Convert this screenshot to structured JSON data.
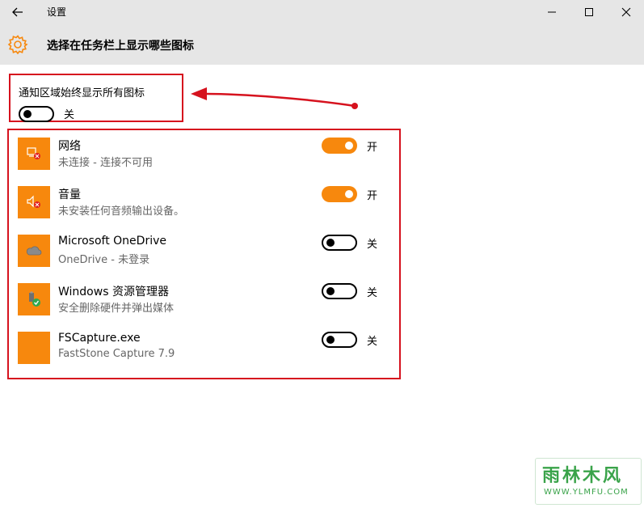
{
  "window": {
    "title": "设置",
    "controls": {
      "minimize": "minimize-icon",
      "maximize": "maximize-icon",
      "close": "close-icon"
    }
  },
  "header": {
    "icon": "gear-icon",
    "title": "选择在任务栏上显示哪些图标"
  },
  "master": {
    "label": "通知区域始终显示所有图标",
    "on": false,
    "state_label": "关"
  },
  "items": [
    {
      "name": "网络",
      "desc": "未连接 - 连接不可用",
      "on": true,
      "state_label": "开",
      "icon": "network-error-icon"
    },
    {
      "name": "音量",
      "desc": "未安装任何音频输出设备。",
      "on": true,
      "state_label": "开",
      "icon": "volume-error-icon"
    },
    {
      "name": "Microsoft OneDrive",
      "desc": "OneDrive - 未登录",
      "on": false,
      "state_label": "关",
      "icon": "cloud-icon"
    },
    {
      "name": "Windows 资源管理器",
      "desc": "安全删除硬件并弹出媒体",
      "on": false,
      "state_label": "关",
      "icon": "usb-eject-icon"
    },
    {
      "name": "FSCapture.exe",
      "desc": "FastStone Capture 7.9",
      "on": false,
      "state_label": "关",
      "icon": "app-icon"
    }
  ],
  "colors": {
    "accent": "#f7880d",
    "annotation": "#d6121e",
    "titlebar": "#e6e6e6"
  },
  "watermark": {
    "logo": "雨林木风",
    "url": "WWW.YLMFU.COM"
  }
}
